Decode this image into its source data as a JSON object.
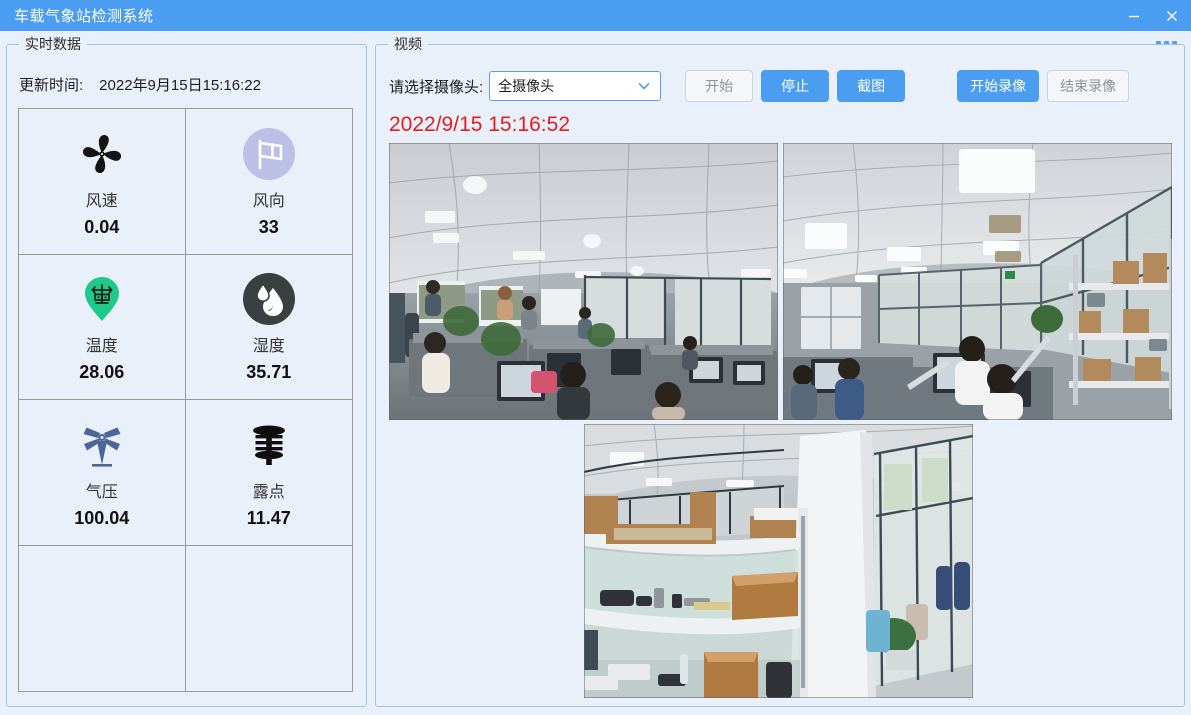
{
  "window": {
    "title": "车载气象站检测系统",
    "minimize_icon": "minimize-icon",
    "close_icon": "close-icon",
    "accent_color": "#4a9df0",
    "background_color": "#eaf0fa"
  },
  "left_panel": {
    "legend": "实时数据",
    "update_time_label": "更新时间:",
    "update_time_value": "2022年9月15日15:16:22",
    "sensors": [
      {
        "icon": "fan-icon",
        "name": "风速",
        "value": "0.04"
      },
      {
        "icon": "flag-icon",
        "name": "风向",
        "value": "33"
      },
      {
        "icon": "weather-station-pin-icon",
        "name": "温度",
        "value": "28.06"
      },
      {
        "icon": "water-drops-icon",
        "name": "湿度",
        "value": "35.71"
      },
      {
        "icon": "windmill-icon",
        "name": "气压",
        "value": "100.04"
      },
      {
        "icon": "dew-point-icon",
        "name": "露点",
        "value": "11.47"
      },
      {
        "icon": "",
        "name": "",
        "value": ""
      },
      {
        "icon": "",
        "name": "",
        "value": ""
      }
    ]
  },
  "right_panel": {
    "legend": "视频",
    "camera_label": "请选择摄像头:",
    "camera_selected": "全摄像头",
    "camera_options": [
      "全摄像头"
    ],
    "dropdown_icon": "chevron-down-icon",
    "buttons": [
      {
        "label": "开始",
        "state": "disabled"
      },
      {
        "label": "停止",
        "state": "active"
      },
      {
        "label": "截图",
        "state": "active"
      },
      {
        "label": "开始录像",
        "state": "active"
      },
      {
        "label": "结束录像",
        "state": "disabled"
      }
    ],
    "video_timestamp": "2022/9/15 15:16:52",
    "video_timestamp_color": "#e11d21",
    "video_feeds": [
      {
        "name": "camera-feed-1",
        "scene": "open-plan office with ceiling lights, glass partitions and staff at desks"
      },
      {
        "name": "camera-feed-2",
        "scene": "office interior with ceiling panel lights, glass wall and storage shelving"
      },
      {
        "name": "camera-feed-3",
        "scene": "storage shelving with cardboard boxes beside glass partition wall"
      }
    ]
  }
}
